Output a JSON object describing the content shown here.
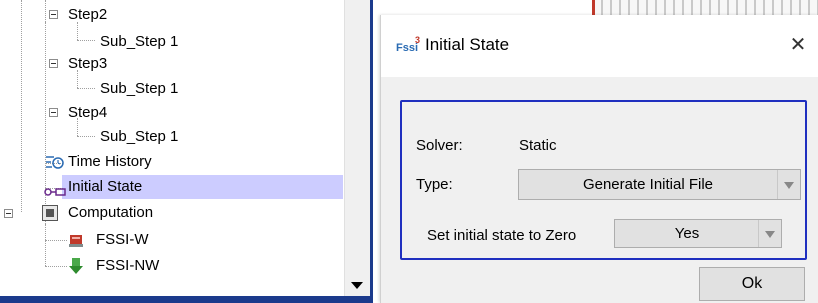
{
  "tree": {
    "items": [
      {
        "label": "Step2"
      },
      {
        "label": "Sub_Step 1"
      },
      {
        "label": "Step3"
      },
      {
        "label": "Sub_Step 1"
      },
      {
        "label": "Step4"
      },
      {
        "label": "Sub_Step 1"
      },
      {
        "label": "Time History",
        "icon": "time-history-icon"
      },
      {
        "label": "Initial State",
        "icon": "initial-state-icon",
        "selected": true
      },
      {
        "label": "Computation",
        "icon": "computation-icon"
      },
      {
        "label": "FSSI-W",
        "icon": "fssi-w-icon"
      },
      {
        "label": "FSSI-NW",
        "icon": "fssi-nw-icon"
      }
    ],
    "selection_color": "#ccccff"
  },
  "dialog": {
    "title": "Initial State",
    "app_icon_text": "Fssi",
    "app_icon_sup": "3",
    "close_symbol": "✕",
    "solver_label": "Solver:",
    "solver_value": "Static",
    "type_label": "Type:",
    "type_value": "Generate Initial File",
    "zero_label": "Set initial state to Zero",
    "zero_value": "Yes",
    "ok_label": "Ok",
    "group_border_color": "#1f2fbf"
  }
}
